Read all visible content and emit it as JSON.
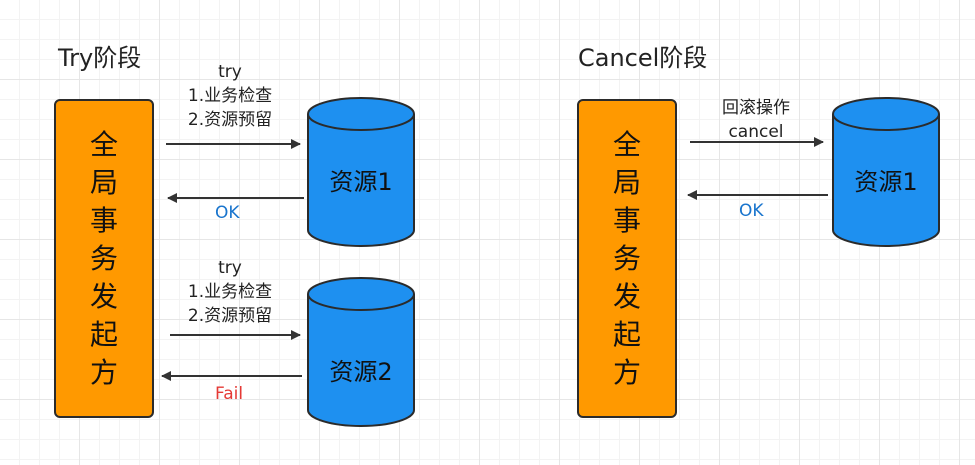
{
  "try_phase": {
    "title": "Try阶段",
    "initiator_chars": [
      "全",
      "局",
      "事",
      "务",
      "发",
      "起",
      "方"
    ],
    "resource1": {
      "label": "资源1",
      "request_lines": [
        "try",
        "1.业务检查",
        "2.资源预留"
      ],
      "reply": "OK"
    },
    "resource2": {
      "label": "资源2",
      "request_lines": [
        "try",
        "1.业务检查",
        "2.资源预留"
      ],
      "reply": "Fail"
    }
  },
  "cancel_phase": {
    "title": "Cancel阶段",
    "initiator_chars": [
      "全",
      "局",
      "事",
      "务",
      "发",
      "起",
      "方"
    ],
    "resource1": {
      "label": "资源1",
      "request_lines": [
        "回滚操作",
        "cancel"
      ],
      "reply": "OK"
    }
  },
  "colors": {
    "initiator_fill": "#ff9900",
    "resource_fill": "#1e90f0",
    "ok_text": "#1874cd",
    "fail_text": "#e53935",
    "arrow": "#333333"
  }
}
